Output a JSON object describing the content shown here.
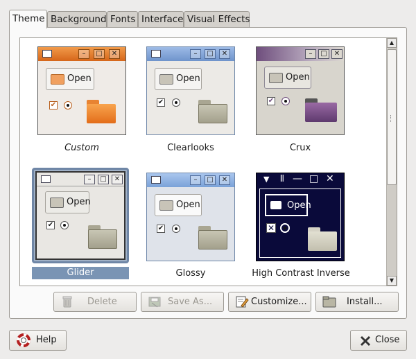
{
  "tabs": [
    {
      "label": "Theme",
      "active": true
    },
    {
      "label": "Background",
      "active": false
    },
    {
      "label": "Fonts",
      "active": false
    },
    {
      "label": "Interface",
      "active": false
    },
    {
      "label": "Visual Effects",
      "active": false
    }
  ],
  "themes": [
    {
      "name": "Custom",
      "style": "italic",
      "selected": false,
      "preview_open_label": "Open",
      "accent": "#e0701e"
    },
    {
      "name": "Clearlooks",
      "style": "normal",
      "selected": false,
      "preview_open_label": "Open",
      "accent": "#7aa2d8"
    },
    {
      "name": "Crux",
      "style": "normal",
      "selected": false,
      "preview_open_label": "Open",
      "accent": "#6f4e7d"
    },
    {
      "name": "Glider",
      "style": "normal",
      "selected": true,
      "preview_open_label": "Open",
      "accent": "#6f7d91"
    },
    {
      "name": "Glossy",
      "style": "normal",
      "selected": false,
      "preview_open_label": "Open",
      "accent": "#7aa2d8"
    },
    {
      "name": "High Contrast Inverse",
      "style": "normal",
      "selected": false,
      "preview_open_label": "Open",
      "accent": "#0a0a3a"
    }
  ],
  "actions": {
    "delete_label": "Delete",
    "save_as_label": "Save As...",
    "customize_label": "Customize...",
    "install_label": "Install..."
  },
  "footer": {
    "help_label": "Help",
    "close_label": "Close"
  },
  "colors": {
    "selection": "#7a94b4",
    "window_bg": "#edeceb"
  }
}
